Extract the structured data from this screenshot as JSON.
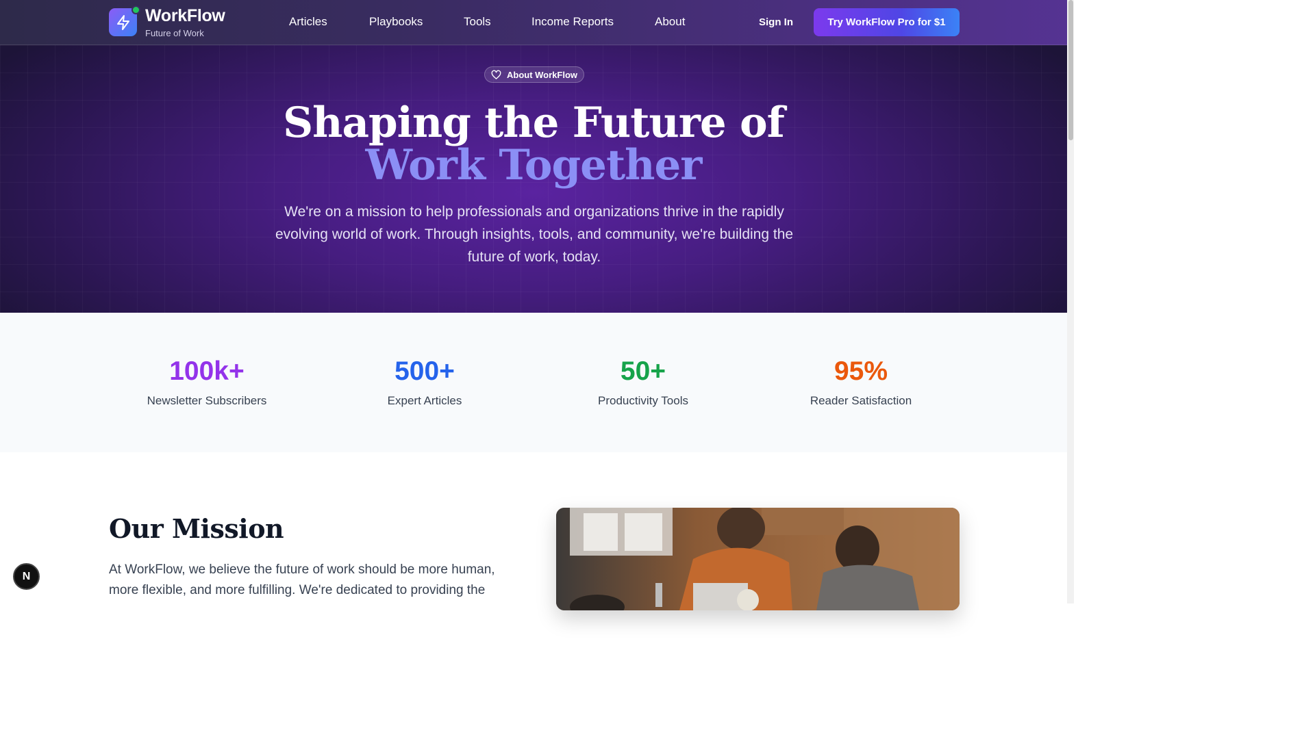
{
  "nav": {
    "brand": "WorkFlow",
    "brand_sub": "Future of Work",
    "links": [
      "Articles",
      "Playbooks",
      "Tools",
      "Income Reports",
      "About"
    ],
    "sign_in": "Sign In",
    "cta": "Try WorkFlow Pro for $1",
    "logo_icon": "lightning-bolt-icon"
  },
  "hero": {
    "pill": "About WorkFlow",
    "pill_icon": "heart-icon",
    "title_line1": "Shaping the Future of",
    "title_line2": "Work Together",
    "paragraph": "We're on a mission to help professionals and organizations thrive in the rapidly evolving world of work. Through insights, tools, and community, we're building the future of work, today."
  },
  "stats": [
    {
      "value": "100k+",
      "label": "Newsletter Subscribers",
      "color": "#9333ea"
    },
    {
      "value": "500+",
      "label": "Expert Articles",
      "color": "#2563eb"
    },
    {
      "value": "50+",
      "label": "Productivity Tools",
      "color": "#16a34a"
    },
    {
      "value": "95%",
      "label": "Reader Satisfaction",
      "color": "#ea580c"
    }
  ],
  "mission": {
    "heading": "Our Mission",
    "paragraph": "At WorkFlow, we believe the future of work should be more human, more flexible, and more fulfilling. We're dedicated to providing the"
  },
  "badge": "N",
  "colors": {
    "accent_purple": "#7c3aed",
    "hero_title_accent": "#8b8ff5"
  }
}
